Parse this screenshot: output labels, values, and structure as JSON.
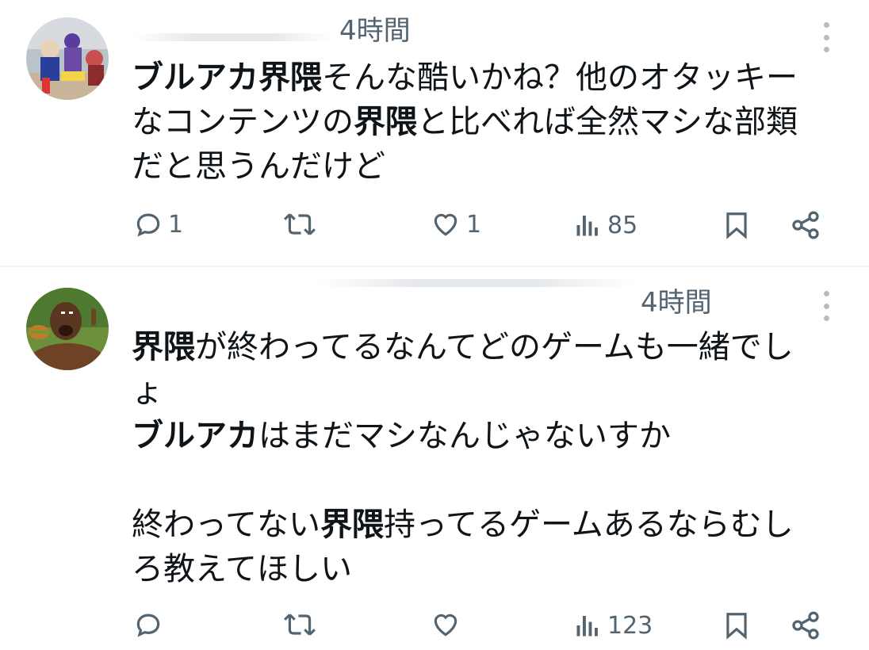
{
  "tweets": [
    {
      "time": "4時間",
      "lines": [
        [
          {
            "text": "ブルアカ界隈",
            "bold": true
          },
          {
            "text": "そんな酷いかね？他のオタッキー",
            "bold": false
          }
        ],
        [
          {
            "text": "なコンテンツの",
            "bold": false
          },
          {
            "text": "界隈",
            "bold": true
          },
          {
            "text": "と比べれば全然マシな部類",
            "bold": false
          }
        ],
        [
          {
            "text": "だと思うんだけど",
            "bold": false
          }
        ]
      ],
      "actions": {
        "reply_count": "1",
        "retweet_count": "",
        "like_count": "1",
        "view_count": "85"
      }
    },
    {
      "time": "4時間",
      "lines": [
        [
          {
            "text": "界隈",
            "bold": true
          },
          {
            "text": "が終わってるなんてどのゲームも一緒でし",
            "bold": false
          }
        ],
        [
          {
            "text": "ょ",
            "bold": false
          }
        ],
        [
          {
            "text": "ブルアカ",
            "bold": true
          },
          {
            "text": "はまだマシなんじゃないすか",
            "bold": false
          }
        ],
        [],
        [
          {
            "text": "終わってない",
            "bold": false
          },
          {
            "text": "界隈",
            "bold": true
          },
          {
            "text": "持ってるゲームあるならむし",
            "bold": false
          }
        ],
        [
          {
            "text": "ろ教えてほしい",
            "bold": false
          }
        ]
      ],
      "actions": {
        "reply_count": "",
        "retweet_count": "",
        "like_count": "",
        "view_count": "123"
      }
    }
  ],
  "icons": {
    "reply": "reply-icon",
    "retweet": "retweet-icon",
    "like": "heart-icon",
    "views": "views-icon",
    "bookmark": "bookmark-icon",
    "share": "share-icon",
    "more": "more-icon"
  },
  "colors": {
    "text": "#0f1419",
    "secondary": "#536471",
    "divider": "#eff3f4"
  }
}
